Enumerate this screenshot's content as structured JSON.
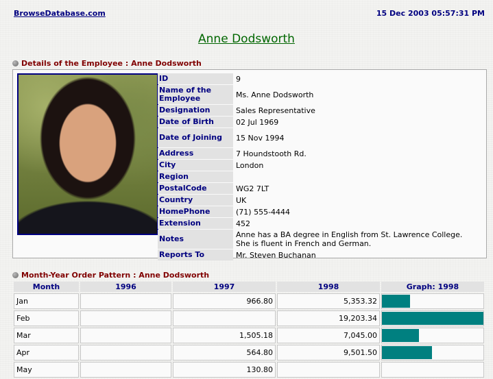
{
  "header": {
    "site": "BrowseDatabase.com",
    "datetime": "15 Dec 2003 05:57:31 PM"
  },
  "title": "Anne Dodsworth",
  "details_section": "Details of the Employee : Anne Dodsworth",
  "employee_fields": [
    {
      "label": "ID",
      "value": "9"
    },
    {
      "label": "Name of the Employee",
      "value": "Ms. Anne Dodsworth"
    },
    {
      "label": "Designation",
      "value": "Sales Representative"
    },
    {
      "label": "Date of Birth",
      "value": "02 Jul 1969"
    },
    {
      "label": "Date of Joining",
      "value": "15 Nov 1994"
    },
    {
      "label": "Address",
      "value": "7 Houndstooth Rd."
    },
    {
      "label": "City",
      "value": "London"
    },
    {
      "label": "Region",
      "value": ""
    },
    {
      "label": "PostalCode",
      "value": "WG2 7LT"
    },
    {
      "label": "Country",
      "value": "UK"
    },
    {
      "label": "HomePhone",
      "value": "(71) 555-4444"
    },
    {
      "label": "Extension",
      "value": "452"
    },
    {
      "label": "Notes",
      "value": "Anne has a BA degree in English from St. Lawrence College. She is fluent in French and German."
    },
    {
      "label": "Reports To",
      "value": "Mr. Steven Buchanan"
    }
  ],
  "orders_section": "Month-Year Order Pattern : Anne Dodsworth",
  "orders_table": {
    "headers": [
      "Month",
      "1996",
      "1997",
      "1998",
      "Graph: 1998"
    ],
    "rows": [
      {
        "month": "Jan",
        "y1996": "",
        "y1997": "966.80",
        "y1998": "5,353.32",
        "bar": 0.279
      },
      {
        "month": "Feb",
        "y1996": "",
        "y1997": "",
        "y1998": "19,203.34",
        "bar": 1.0
      },
      {
        "month": "Mar",
        "y1996": "",
        "y1997": "1,505.18",
        "y1998": "7,045.00",
        "bar": 0.367
      },
      {
        "month": "Apr",
        "y1996": "",
        "y1997": "564.80",
        "y1998": "9,501.50",
        "bar": 0.495
      },
      {
        "month": "May",
        "y1996": "",
        "y1997": "130.80",
        "y1998": "",
        "bar": 0
      }
    ]
  },
  "colors": {
    "bar": "#008080",
    "label_text": "#000080",
    "section_text": "#800000",
    "title": "#006600"
  }
}
